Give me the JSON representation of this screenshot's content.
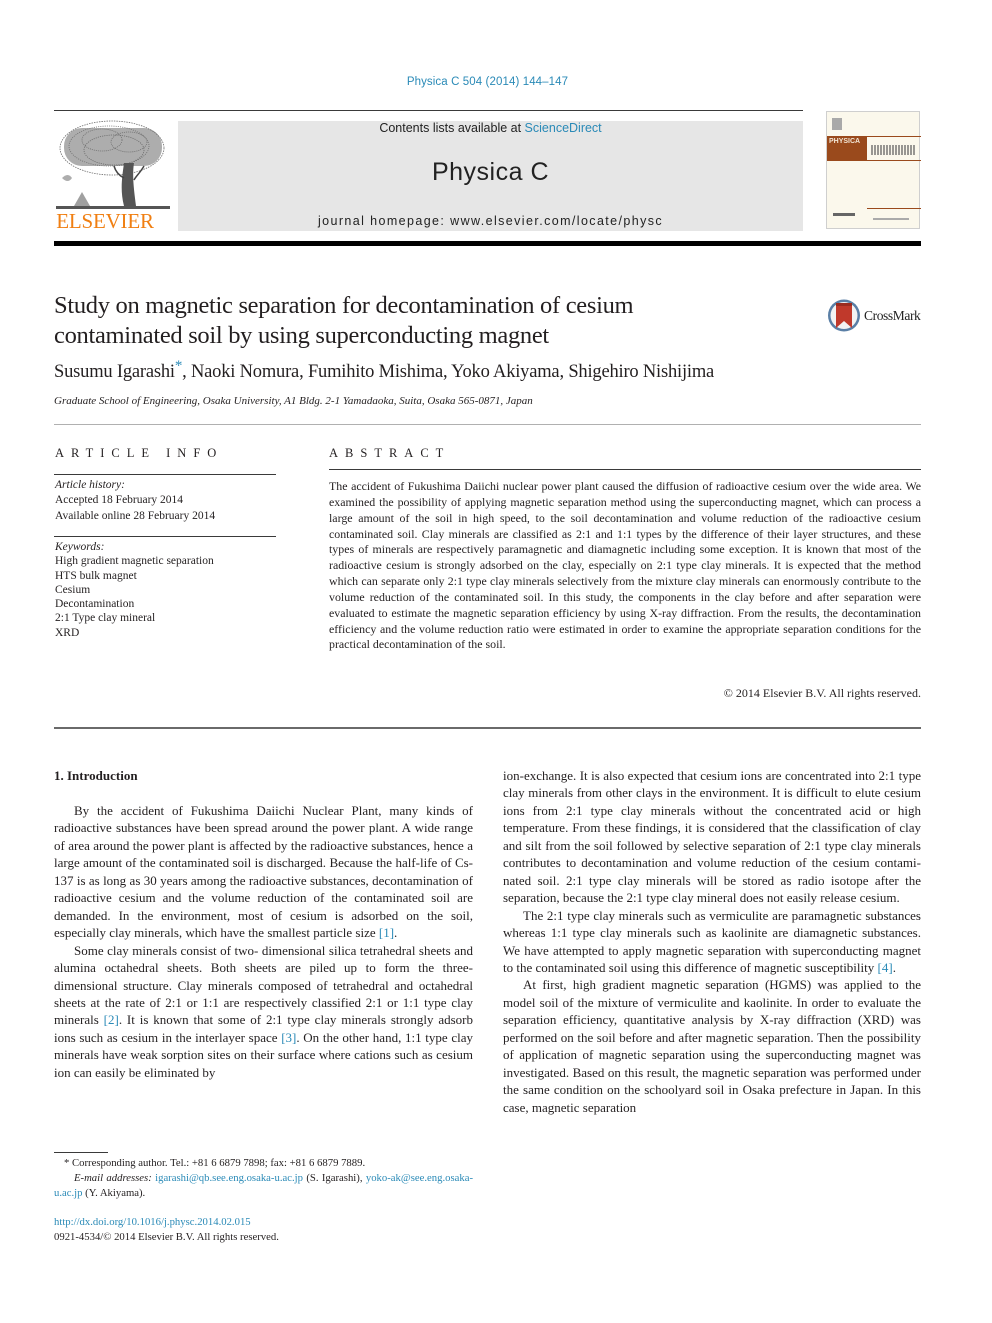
{
  "header": {
    "citation": "Physica C 504 (2014) 144–147",
    "contents_prefix": "Contents lists available at ",
    "contents_link": "ScienceDirect",
    "journal_name": "Physica C",
    "homepage_line": "journal homepage: www.elsevier.com/locate/physc",
    "publisher_logo_text": "ELSEVIER",
    "cover_band_text": "PHYSICA",
    "colors": {
      "link": "#2a8ab7",
      "elsevier_orange": "#f07f12",
      "cover_band": "#9a4a1c",
      "banner_bg": "#e6e6e6"
    }
  },
  "article": {
    "title_line1": "Study on magnetic separation for decontamination of cesium",
    "title_line2": "contaminated soil by using superconducting magnet",
    "crossmark_label": "CrossMark",
    "authors": [
      {
        "name": "Susumu Igarashi",
        "corresponding_mark": "*"
      },
      {
        "name": "Naoki Nomura"
      },
      {
        "name": "Fumihito Mishima"
      },
      {
        "name": "Yoko Akiyama"
      },
      {
        "name": "Shigehiro Nishijima"
      }
    ],
    "affiliation": "Graduate School of Engineering, Osaka University, A1 Bldg. 2-1 Yamadaoka, Suita, Osaka 565-0871, Japan"
  },
  "article_info": {
    "heading": "ARTICLE INFO",
    "history_label": "Article history:",
    "history": [
      "Accepted 18 February 2014",
      "Available online 28 February 2014"
    ],
    "keywords_label": "Keywords:",
    "keywords": [
      "High gradient magnetic separation",
      "HTS bulk magnet",
      "Cesium",
      "Decontamination",
      "2:1 Type clay mineral",
      "XRD"
    ]
  },
  "abstract": {
    "heading": "ABSTRACT",
    "text": "The accident of Fukushima Daiichi nuclear power plant caused the diffusion of radioactive cesium over the wide area. We examined the possibility of applying magnetic separation method using the supercon­ducting magnet, which can process a large amount of the soil in high speed, to the soil decontamination and volume reduction of the radioactive cesium contaminated soil. Clay minerals are classified as 2:1 and 1:1 types by the difference of their layer structures, and these types of minerals are respectively para­magnetic and diamagnetic including some exception. It is known that most of the radioactive cesium is strongly adsorbed on the clay, especially on 2:1 type clay minerals. It is expected that the method which can separate only 2:1 type clay minerals selectively from the mixture clay minerals can enor­mously contribute to the volume reduction of the contaminated soil. In this study, the components in the clay before and after separation were evaluated to estimate the magnetic separation efficiency by using X-ray diffraction. From the results, the decontamination efficiency and the volume reduction ratio were estimated in order to examine the appropriate separation conditions for the practical decontamina­tion of the soil.",
    "copyright": "© 2014 Elsevier B.V. All rights reserved."
  },
  "body": {
    "section_heading": "1. Introduction",
    "left_paragraphs": [
      {
        "text_before": "By the accident of Fukushima Daiichi Nuclear Plant, many kinds of radioactive substances have been spread around the power plant. A wide range of area around the power plant is affected by the radioactive substances, hence a large amount of the contami­nated soil is discharged. Because the half-life of Cs-137 is as long as 30 years among the radioactive substances, decontamination of radioactive cesium and the volume reduction of the contami­nated soil are demanded. In the environment, most of cesium is ad­sorbed on the soil, especially clay minerals, which have the smallest particle size ",
        "ref": "[1]",
        "text_after": "."
      },
      {
        "text_before": "Some clay minerals consist of two- dimensional silica tetrahe­dral sheets and alumina octahedral sheets. Both sheets are piled up to form the three-dimensional structure. Clay minerals com­posed of tetrahedral and octahedral sheets at the rate of 2:1 or 1:1 are respectively classified 2:1 or 1:1 type clay minerals ",
        "ref": "[2]",
        "text_mid": ". It is known that some of 2:1 type clay minerals strongly adsorb ions such as cesium in the interlayer space ",
        "ref2": "[3]",
        "text_after": ". On the other hand, 1:1 type clay minerals have weak sorption sites on their surface where cations such as cesium ion can easily be eliminated by"
      }
    ],
    "right_paragraphs": [
      {
        "text": "ion-exchange. It is also expected that cesium ions are concentrated into 2:1 type clay minerals from other clays in the environment. It is difficult to elute cesium ions from 2:1 type clay minerals without the concentrated acid or high temperature. From these findings, it is considered that the classification of clay and silt from the soil fol­lowed by selective separation of 2:1 type clay minerals contributes to decontamination and volume reduction of the cesium contami­nated soil. 2:1 type clay minerals will be stored as radio isotope after the separation, because the 2:1 type clay mineral does not easily release cesium."
      },
      {
        "text_before": "The 2:1 type clay minerals such as vermiculite are paramag­netic substances whereas 1:1 type clay minerals such as kaolinite are diamagnetic substances. We have attempted to apply magnetic separation with superconducting magnet to the contaminated soil using this difference of magnetic susceptibility ",
        "ref": "[4]",
        "text_after": "."
      },
      {
        "text": "At first, high gradient magnetic separation (HGMS) was applied to the model soil of the mixture of vermiculite and kaolinite. In or­der to evaluate the separation efficiency, quantitative analysis by X-ray diffraction (XRD) was performed on the soil before and after magnetic separation. Then the possibility of application of mag­netic separation using the superconducting magnet was investi­gated. Based on this result, the magnetic separation was performed under the same condition on the schoolyard soil in Osaka prefecture in Japan. In this case, magnetic separation"
      }
    ]
  },
  "footnote": {
    "star": "*",
    "corresponding": " Corresponding author. Tel.: +81 6 6879 7898; fax: +81 6 6879 7889.",
    "email_label": "E-mail addresses:",
    "email1": "igarashi@qb.see.eng.osaka-u.ac.jp",
    "email1_owner": " (S. Igarashi), ",
    "email2": "yoko-ak@see.eng.osaka-u.ac.jp",
    "email2_owner": " (Y. Akiyama).",
    "doi": "http://dx.doi.org/10.1016/j.physc.2014.02.015",
    "issn_line": "0921-4534/© 2014 Elsevier B.V. All rights reserved."
  }
}
